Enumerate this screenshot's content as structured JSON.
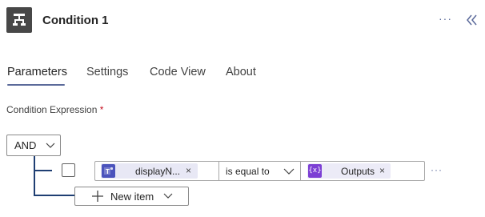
{
  "header": {
    "title": "Condition 1",
    "icon": "condition-flowchart-icon",
    "more_label": "···",
    "collapse_icon": "double-chevron-left-icon"
  },
  "tabs": [
    {
      "label": "Parameters",
      "active": true
    },
    {
      "label": "Settings",
      "active": false
    },
    {
      "label": "Code View",
      "active": false
    },
    {
      "label": "About",
      "active": false
    }
  ],
  "condition": {
    "label": "Condition Expression",
    "required_marker": "*",
    "group_operator": "AND",
    "rows": [
      {
        "left_token": {
          "text": "displayN...",
          "icon": "teams-icon",
          "remove": "×"
        },
        "operator": "is equal to",
        "right_token": {
          "text": "Outputs",
          "icon": "expression-icon",
          "icon_glyph": "{x}",
          "remove": "×"
        },
        "more_label": "···"
      }
    ],
    "new_item_label": "New item"
  },
  "colors": {
    "accent": "#5b6a9a",
    "tree_line": "#1f3f73",
    "teams": "#4b53bc",
    "expression": "#7c3fd4",
    "required": "#c50f1f"
  }
}
